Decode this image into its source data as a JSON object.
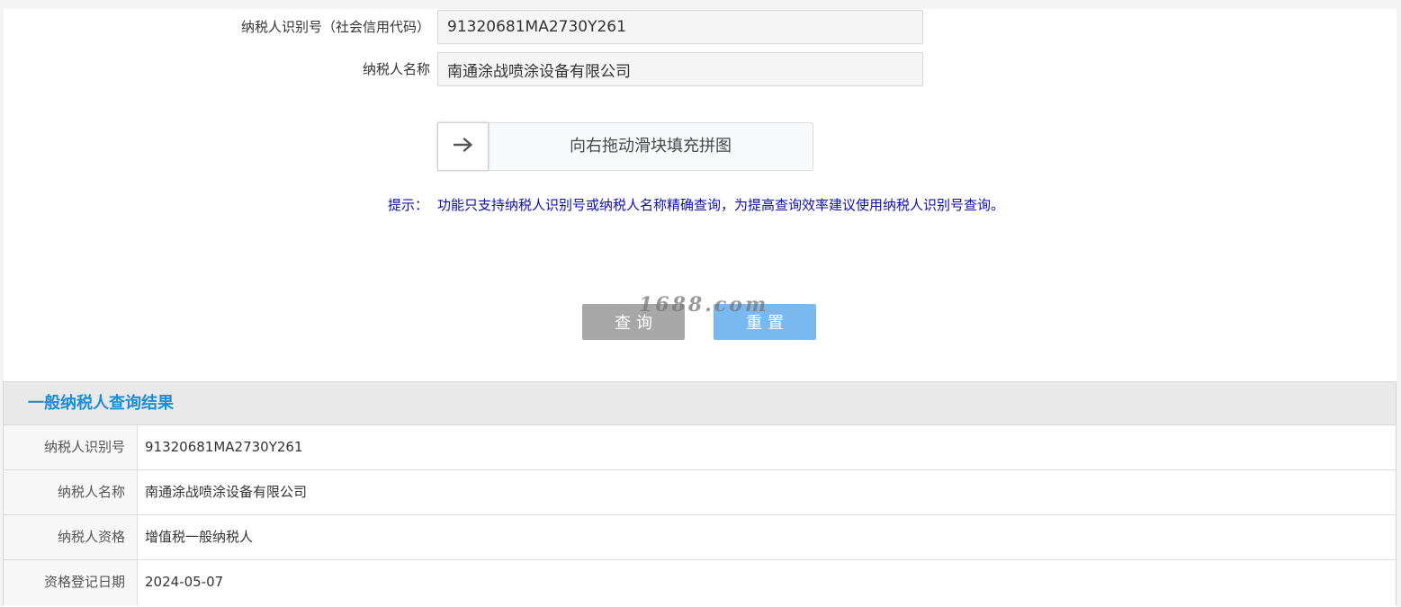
{
  "form": {
    "taxpayer_id": {
      "label": "纳税人识别号（社会信用代码）",
      "value": "91320681MA2730Y261"
    },
    "taxpayer_name": {
      "label": "纳税人名称",
      "value": "南通涂战喷涂设备有限公司"
    },
    "slider": {
      "text": "向右拖动滑块填充拼图",
      "handle_icon": "arrow-right-icon"
    },
    "tip": {
      "label": "提示：",
      "text": "功能只支持纳税人识别号或纳税人名称精确查询，为提高查询效率建议使用纳税人识别号查询。"
    },
    "watermark": "1688.com",
    "buttons": {
      "query": "查询",
      "reset": "重置"
    }
  },
  "results": {
    "title": "一般纳税人查询结果",
    "rows": [
      {
        "key": "纳税人识别号",
        "value": "91320681MA2730Y261"
      },
      {
        "key": "纳税人名称",
        "value": "南通涂战喷涂设备有限公司"
      },
      {
        "key": "纳税人资格",
        "value": "增值税一般纳税人"
      },
      {
        "key": "资格登记日期",
        "value": "2024-05-07"
      }
    ]
  },
  "colors": {
    "tip": "#0f0fa8",
    "results_title": "#1a8fd8",
    "query_button": "#a7a7a7",
    "reset_button": "#7ab8f0"
  }
}
